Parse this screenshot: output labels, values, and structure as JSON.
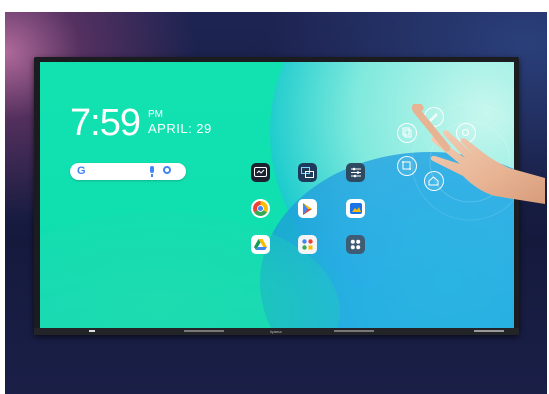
{
  "home": {
    "time": "7:59",
    "ampm": "PM",
    "date": "APRIL: 29"
  },
  "search_widget": {
    "logo": "G",
    "icons": [
      "mic-icon",
      "lens-icon"
    ]
  },
  "apps": [
    {
      "name": "whiteboard-app-icon",
      "color": "#1b2330"
    },
    {
      "name": "screen-share-app-icon",
      "color": "#1e3a5a"
    },
    {
      "name": "settings-app-icon",
      "color": "#2e4a62"
    },
    {
      "name": "chrome-app-icon",
      "color": "#ffffff"
    },
    {
      "name": "play-store-app-icon",
      "color": "#ffffff"
    },
    {
      "name": "gallery-app-icon",
      "color": "#ffffff"
    },
    {
      "name": "drive-app-icon",
      "color": "#ffffff"
    },
    {
      "name": "google-folder-icon",
      "color": "#ffffff"
    },
    {
      "name": "all-apps-icon",
      "color": "#3e5c74"
    }
  ],
  "floating_tools": [
    "pen-tool-icon",
    "copy-tool-icon",
    "crop-tool-icon",
    "annotate-tool-icon",
    "home-tool-icon",
    "settings-tool-icon"
  ],
  "brand": "iiyama"
}
